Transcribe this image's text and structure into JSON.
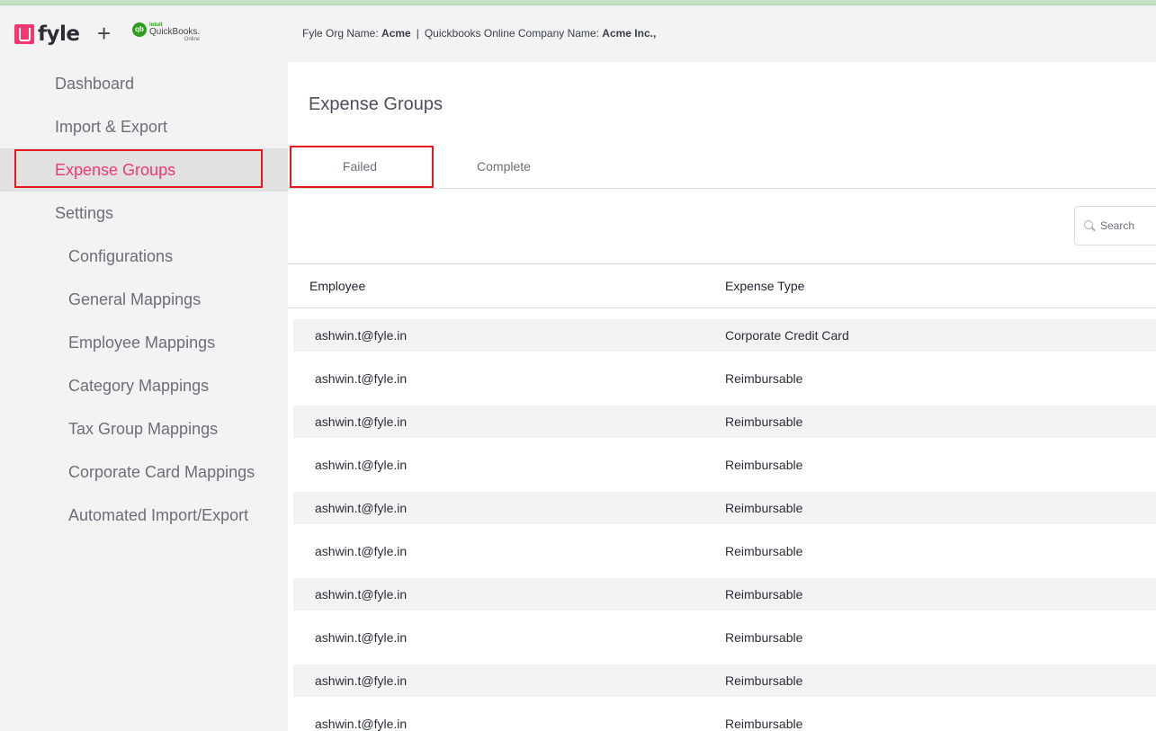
{
  "header": {
    "brand": "fyle",
    "plus": "+",
    "qb_intuit": "intuit",
    "qb_brand": "QuickBooks.",
    "qb_online": "Online",
    "qb_mark": "qb",
    "org_label": "Fyle Org Name:",
    "org_value": "Acme",
    "separator": "|",
    "company_label": "Quickbooks Online Company Name:",
    "company_value": "Acme Inc.,"
  },
  "sidebar": {
    "items": [
      {
        "label": "Dashboard",
        "level": "top",
        "active": false
      },
      {
        "label": "Import & Export",
        "level": "top",
        "active": false
      },
      {
        "label": "Expense Groups",
        "level": "top",
        "active": true
      },
      {
        "label": "Settings",
        "level": "top",
        "active": false
      },
      {
        "label": "Configurations",
        "level": "sub",
        "active": false
      },
      {
        "label": "General Mappings",
        "level": "sub",
        "active": false
      },
      {
        "label": "Employee Mappings",
        "level": "sub",
        "active": false
      },
      {
        "label": "Category Mappings",
        "level": "sub",
        "active": false
      },
      {
        "label": "Tax Group Mappings",
        "level": "sub",
        "active": false
      },
      {
        "label": "Corporate Card Mappings",
        "level": "sub",
        "active": false
      },
      {
        "label": "Automated Import/Export",
        "level": "sub",
        "active": false
      }
    ]
  },
  "main": {
    "title": "Expense Groups",
    "tabs": [
      {
        "label": "Failed",
        "selected": true
      },
      {
        "label": "Complete",
        "selected": false
      }
    ],
    "search": {
      "placeholder": "Search",
      "value": ""
    },
    "table": {
      "columns": [
        "Employee",
        "Expense Type"
      ],
      "rows": [
        {
          "employee": "ashwin.t@fyle.in",
          "expense_type": "Corporate Credit Card"
        },
        {
          "employee": "ashwin.t@fyle.in",
          "expense_type": "Reimbursable"
        },
        {
          "employee": "ashwin.t@fyle.in",
          "expense_type": "Reimbursable"
        },
        {
          "employee": "ashwin.t@fyle.in",
          "expense_type": "Reimbursable"
        },
        {
          "employee": "ashwin.t@fyle.in",
          "expense_type": "Reimbursable"
        },
        {
          "employee": "ashwin.t@fyle.in",
          "expense_type": "Reimbursable"
        },
        {
          "employee": "ashwin.t@fyle.in",
          "expense_type": "Reimbursable"
        },
        {
          "employee": "ashwin.t@fyle.in",
          "expense_type": "Reimbursable"
        },
        {
          "employee": "ashwin.t@fyle.in",
          "expense_type": "Reimbursable"
        },
        {
          "employee": "ashwin.t@fyle.in",
          "expense_type": "Reimbursable"
        }
      ]
    }
  },
  "colors": {
    "accent": "#f5366f",
    "highlight_box": "#e8171b",
    "qb_green": "#2ca01c",
    "sidebar_bg": "#f3f3f4"
  },
  "icons": {
    "search": "search-icon",
    "fyle_logo": "fyle-logo-icon",
    "quickbooks_logo": "quickbooks-logo-icon"
  }
}
